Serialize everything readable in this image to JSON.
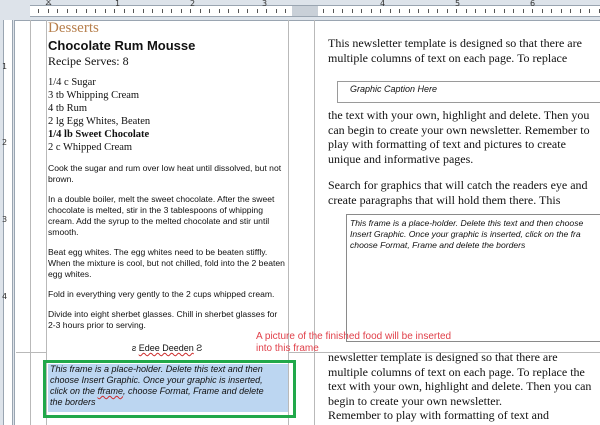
{
  "ruler": {
    "h_numbers": [
      "1",
      "2",
      "3",
      "4",
      "5",
      "6"
    ],
    "v_numbers": [
      "1",
      "2",
      "3",
      "4"
    ]
  },
  "recipe": {
    "section_title": "Desserts",
    "title": "Chocolate Rum Mousse",
    "serves": "Recipe Serves: 8",
    "ingredients": [
      {
        "text": "1/4 c Sugar",
        "bold": false
      },
      {
        "text": "3 tb Whipping Cream",
        "bold": false
      },
      {
        "text": "4 tb Rum",
        "bold": false
      },
      {
        "text": "2 lg Egg Whites, Beaten",
        "bold": false
      },
      {
        "text": "1/4 lb Sweet Chocolate",
        "bold": true
      },
      {
        "text": "2 c Whipped Cream",
        "bold": false
      }
    ],
    "steps": [
      "Cook the sugar and rum over low heat until dissolved, but not brown.",
      "In a double boiler, melt the sweet chocolate. After the sweet chocolate is melted, stir in the 3 tablespoons of whipping cream. Add the syrup to the melted chocolate and stir until smooth.",
      "Beat egg whites. The egg whites need to be beaten stiffly. When the mixture is cool, but not chilled, fold into the 2 beaten egg whites.",
      "Fold in everything very gently to the 2 cups whipped cream.",
      "Divide into eight sherbet glasses. Chill in sherbet glasses for 2-3 hours prior to serving."
    ],
    "signature_left": "ƨ",
    "signature_name": "Edee Deeden",
    "signature_right": "Ƨ"
  },
  "placeholder_frame": {
    "line1": "This frame is a place-holder.  Delete this text and then",
    "line2": "choose Insert Graphic.  Once your graphic is inserted,",
    "line3_a": "click on the ",
    "line3_b": "fframe",
    "line3_c": ", choose Format, Frame and delete",
    "line4": "the borders"
  },
  "annotation": "A picture of the finished food will be inserted into this frame",
  "right": {
    "para1": "This newsletter template is designed so that there are multiple columns of text on each page. To replace",
    "caption": "Graphic Caption Here",
    "para2": "the text with your own, highlight and delete. Then you can begin to create your own newsletter. Remember to play with formatting of text and pictures to create unique and informative pages.",
    "para3": "Search for graphics that will catch the readers eye and create paragraphs that will hold them there. This",
    "ph_line1": "This frame is a place-holder.  Delete this text and then choose",
    "ph_line2": "Insert Graphic.  Once your graphic is inserted, click on the fra",
    "ph_line3": "choose Format, Frame and delete the borders",
    "para4": "newsletter template is designed so that there are multiple columns of text on each page. To replace the text with your own, highlight and delete. Then you can begin to create your own newsletter.",
    "para5": "Remember to play with formatting of text and"
  }
}
